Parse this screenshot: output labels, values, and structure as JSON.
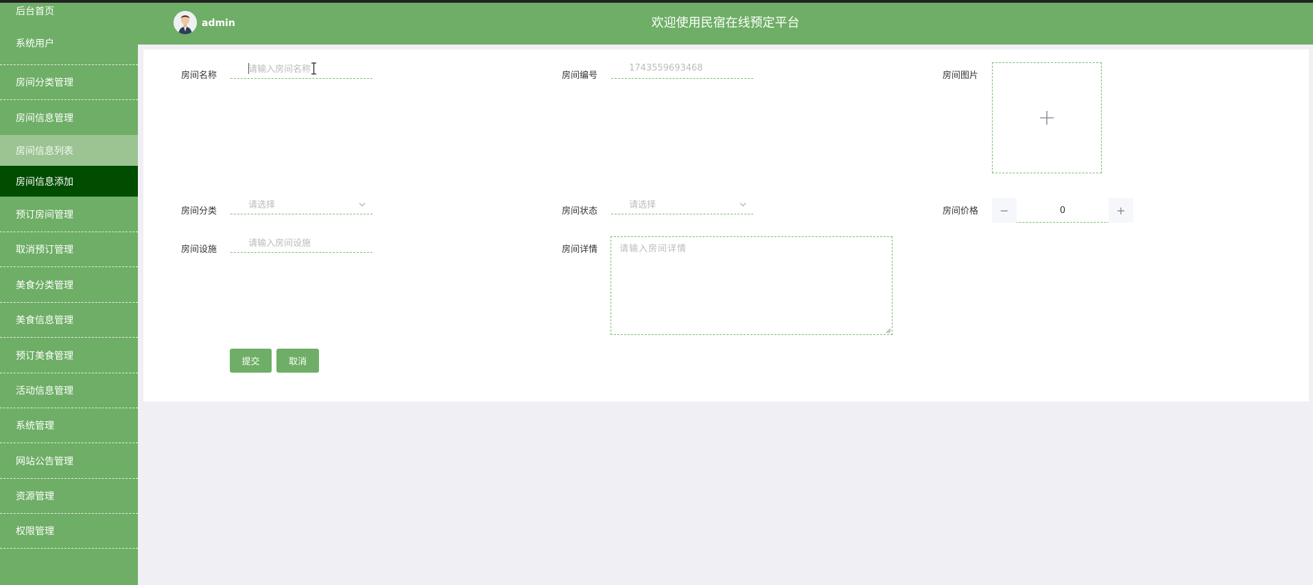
{
  "sidebar": {
    "items": [
      {
        "label": "后台首页"
      },
      {
        "label": "系统用户"
      },
      {
        "label": "房间分类管理"
      },
      {
        "label": "房间信息管理"
      },
      {
        "label": "房间信息列表"
      },
      {
        "label": "房间信息添加"
      },
      {
        "label": "预订房间管理"
      },
      {
        "label": "取消预订管理"
      },
      {
        "label": "美食分类管理"
      },
      {
        "label": "美食信息管理"
      },
      {
        "label": "预订美食管理"
      },
      {
        "label": "活动信息管理"
      },
      {
        "label": "系统管理"
      },
      {
        "label": "网站公告管理"
      },
      {
        "label": "资源管理"
      },
      {
        "label": "权限管理"
      }
    ]
  },
  "header": {
    "username": "admin",
    "title": "欢迎使用民宿在线预定平台"
  },
  "form": {
    "room_name": {
      "label": "房间名称",
      "placeholder": "请输入房间名称"
    },
    "room_code": {
      "label": "房间编号",
      "value": "1743559693468"
    },
    "room_image": {
      "label": "房间图片",
      "icon": "plus-icon"
    },
    "room_category": {
      "label": "房间分类",
      "placeholder": "请选择"
    },
    "room_status": {
      "label": "房间状态",
      "placeholder": "请选择"
    },
    "room_price": {
      "label": "房间价格",
      "value": "0",
      "minus": "−",
      "plus": "+"
    },
    "room_facilities": {
      "label": "房间设施",
      "placeholder": "请输入房间设施"
    },
    "room_details": {
      "label": "房间详情",
      "placeholder": "请输入房间详情"
    },
    "submit_label": "提交",
    "cancel_label": "取消"
  },
  "colors": {
    "accent": "#6eae66",
    "active_item": "#004d00",
    "highlight_item": "#9cc493"
  }
}
